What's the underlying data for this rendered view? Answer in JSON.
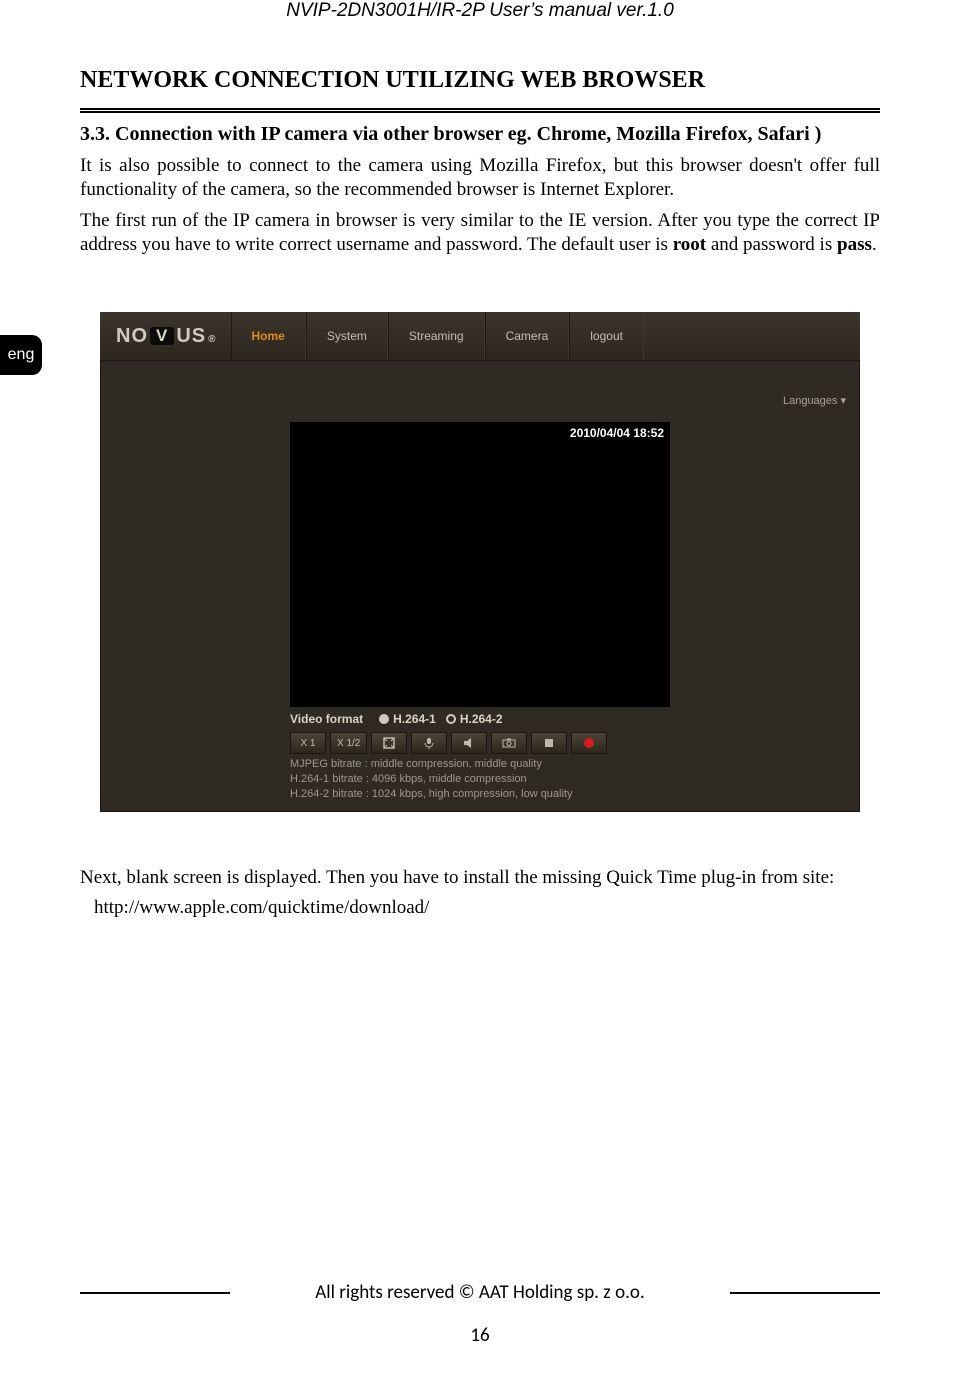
{
  "header": {
    "running": "NVIP-2DN3001H/IR-2P User’s manual ver.1.0"
  },
  "lang_tab": "eng",
  "section": {
    "title": "NETWORK CONNECTION UTILIZING WEB BROWSER",
    "subheading": "3.3. Connection with IP camera via other browser eg. Chrome, Mozilla Firefox, Safari )",
    "para1": "It is also possible to connect to the camera using Mozilla Firefox, but this browser doesn't offer full functionality of the camera, so the recommended browser is Internet Explorer.",
    "para2_pre": "The first run of the IP camera in browser is very similar to  the IE version. After you type the correct IP address you have to write correct username and password. The default user is ",
    "para2_user": "root",
    "para2_mid": " and password is ",
    "para2_pass": "pass",
    "para2_post": "."
  },
  "shot": {
    "logo": {
      "left": "NO",
      "mid": "V",
      "right": "US",
      "reg": "®"
    },
    "nav": [
      "Home",
      "System",
      "Streaming",
      "Camera",
      "logout"
    ],
    "nav_active_index": 0,
    "languages_label": "Languages ▾",
    "timestamp": "2010/04/04 18:52",
    "video_format_label": "Video format",
    "radios": [
      "H.264-1",
      "H.264-2"
    ],
    "radio_selected_index": 0,
    "zoom_buttons": [
      "X 1",
      "X 1/2"
    ],
    "info_lines": [
      "MJPEG bitrate : middle compression, middle quality",
      "H.264-1 bitrate : 4096 kbps, middle compression",
      "H.264-2 bitrate : 1024 kbps, high compression, low quality"
    ]
  },
  "after": {
    "line1": "Next, blank screen is displayed. Then you have to install the missing Quick Time plug-in from site:",
    "line2": "http://www.apple.com/quicktime/download/"
  },
  "footer": {
    "rights": "All rights reserved © AAT Holding sp. z o.o.",
    "page": "16"
  }
}
